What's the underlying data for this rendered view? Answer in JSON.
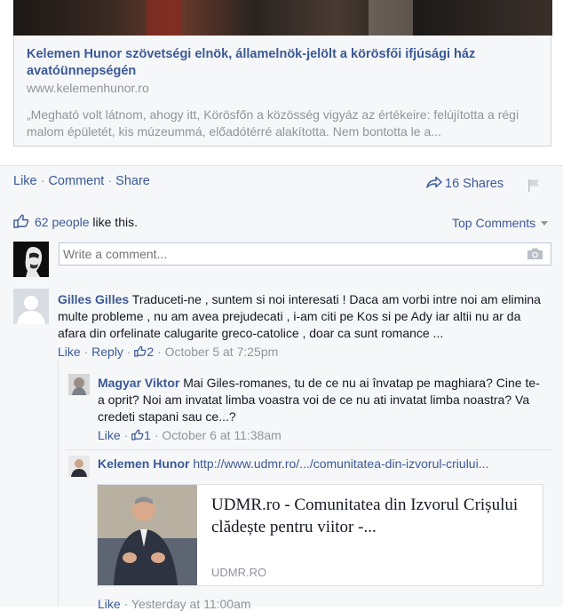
{
  "link_card": {
    "title": "Kelemen Hunor szövetségi elnök, államelnök-jelölt a körösfői ifjúsági ház avatóünnepségén",
    "domain": "www.kelemenhunor.ro",
    "description": "„Megható volt látnom, ahogy itt, Körösfőn a közösség vigyáz az értékeire: felújította a régi malom épületét, kis múzeummá, előadótérré alakította. Nem bontotta le a..."
  },
  "actions": {
    "like": "Like",
    "comment": "Comment",
    "share": "Share",
    "separator": "·"
  },
  "shares": {
    "label": "16 Shares",
    "icon": "share-arrow-icon"
  },
  "likes": {
    "count_text": "62 people",
    "suffix": " like this.",
    "icon": "thumbs-up-icon"
  },
  "sort": {
    "label": "Top Comments"
  },
  "composer": {
    "placeholder": "Write a comment...",
    "icon": "camera-icon"
  },
  "comments": [
    {
      "author": "Gilles Gilles",
      "text": "Traduceti-ne , suntem si noi interesati ! Daca am vorbi intre noi am elimina multe probleme , nu am avea prejudecati , i-am citi pe Kos si pe Ady iar altii nu ar da afara din orfelinate calugarite greco-catolice , doar ca sunt romance ...",
      "like": "Like",
      "reply": "Reply",
      "likes": "2",
      "time": "October 5 at 7:25pm"
    }
  ],
  "replies": [
    {
      "author": "Magyar Viktor",
      "text": "Mai Giles-romanes, tu de ce nu ai învatap pe maghiara? Cine te-a oprit? Noi am invatat limba voastra voi de ce nu ati invatat limba noastra? Va credeti stapani sau ce...?",
      "like": "Like",
      "likes": "1",
      "time": "October 6 at 11:38am"
    },
    {
      "author": "Kelemen Hunor",
      "text": "http://www.udmr.ro/.../comunitatea-din-izvorul-criului...",
      "like": "Like",
      "time": "Yesterday at 11:00am",
      "attachment": {
        "title": "UDMR.ro - Comunitatea din Izvorul Crișului clădește pentru viitor -...",
        "domain": "UDMR.RO"
      }
    }
  ],
  "colors": {
    "link": "#3b5998",
    "muted": "#90949c",
    "background": "#f6f7f8"
  }
}
